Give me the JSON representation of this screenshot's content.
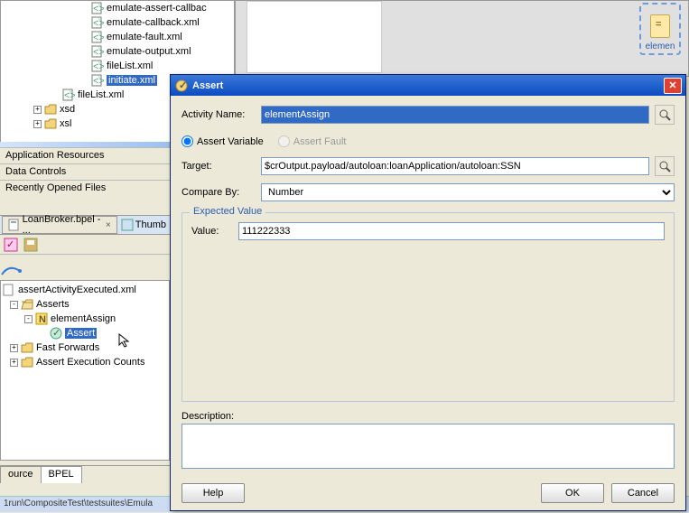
{
  "tree_top": [
    {
      "indent": 100,
      "icon": "xml",
      "label": "emulate-assert-callbac"
    },
    {
      "indent": 100,
      "icon": "xml",
      "label": "emulate-callback.xml"
    },
    {
      "indent": 100,
      "icon": "xml",
      "label": "emulate-fault.xml"
    },
    {
      "indent": 100,
      "icon": "xml",
      "label": "emulate-output.xml"
    },
    {
      "indent": 100,
      "icon": "xml",
      "label": "fileList.xml"
    },
    {
      "indent": 100,
      "icon": "xml",
      "label": "initiate.xml",
      "selected": true
    },
    {
      "indent": 68,
      "icon": "xml",
      "label": "fileList.xml"
    },
    {
      "indent": 36,
      "icon": "folder",
      "expander": "+",
      "label": "xsd"
    },
    {
      "indent": 36,
      "icon": "folder",
      "expander": "+",
      "label": "xsl"
    }
  ],
  "sections": {
    "app_resources": "Application Resources",
    "data_controls": "Data Controls",
    "recent_files": "Recently Opened Files"
  },
  "editor_tab": {
    "label": "LoanBroker.bpel - ...",
    "thumb": "Thumb"
  },
  "lower_tree": {
    "root": "assertActivityExecuted.xml",
    "items": [
      {
        "indent": 8,
        "expander": "-",
        "icon": "folder-open",
        "label": "Asserts"
      },
      {
        "indent": 24,
        "expander": "-",
        "icon": "n",
        "label": "elementAssign"
      },
      {
        "indent": 52,
        "icon": "assert",
        "label": "Assert",
        "selected": true
      },
      {
        "indent": 8,
        "expander": "+",
        "icon": "folder",
        "label": "Fast Forwards"
      },
      {
        "indent": 8,
        "expander": "+",
        "icon": "folder",
        "label": "Assert Execution Counts"
      }
    ]
  },
  "bottom_tabs": {
    "source": "ource",
    "bpel": "BPEL"
  },
  "status_text": "1run\\CompositeTest\\testsuites\\Emula",
  "canvas_element": "elemen",
  "dialog": {
    "title": "Assert",
    "activity_name_label": "Activity Name:",
    "activity_name_value": "elementAssign",
    "assert_variable": "Assert Variable",
    "assert_fault": "Assert Fault",
    "target_label": "Target:",
    "target_value": "$crOutput.payload/autoloan:loanApplication/autoloan:SSN",
    "compare_by_label": "Compare By:",
    "compare_by_value": "Number",
    "expected_value_legend": "Expected Value",
    "value_label": "Value:",
    "value_value": "111222333",
    "description_label": "Description:",
    "help": "Help",
    "ok": "OK",
    "cancel": "Cancel"
  }
}
